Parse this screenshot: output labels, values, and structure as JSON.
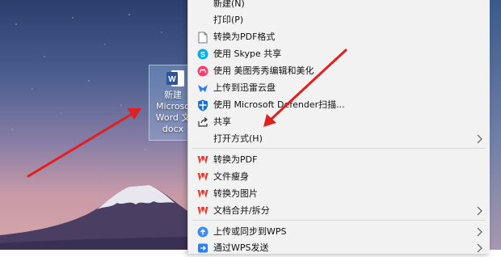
{
  "desktop": {
    "file": {
      "name_lines": [
        "新建",
        "Microso",
        "Word 文",
        "docx"
      ]
    }
  },
  "context_menu": {
    "items": [
      {
        "label": "新建(N)",
        "icon": "none"
      },
      {
        "label": "打印(P)",
        "icon": "none"
      },
      {
        "label": "转换为PDF格式",
        "icon": "document-icon"
      },
      {
        "label": "使用 Skype 共享",
        "icon": "skype-icon"
      },
      {
        "label": "使用 美图秀秀编辑和美化",
        "icon": "meitu-icon"
      },
      {
        "label": "上传到迅雷云盘",
        "icon": "xunlei-icon"
      },
      {
        "label": "使用 Microsoft Defender扫描...",
        "icon": "defender-shield-icon"
      },
      {
        "label": "共享",
        "icon": "share-icon"
      },
      {
        "label": "打开方式(H)",
        "icon": "none",
        "submenu": true
      },
      {
        "label": "转换为PDF",
        "icon": "wps-icon"
      },
      {
        "label": "文件瘦身",
        "icon": "wps-icon"
      },
      {
        "label": "转换为图片",
        "icon": "wps-icon"
      },
      {
        "label": "文档合并/拆分",
        "icon": "wps-icon",
        "submenu": true
      },
      {
        "label": "上传或同步到WPS",
        "icon": "wps-cloud-icon",
        "submenu": true
      },
      {
        "label": "通过WPS发送",
        "icon": "wps-send-icon",
        "submenu": true
      }
    ]
  },
  "colors": {
    "menu_bg": "#f2f2f2",
    "wps_red": "#e63c2e",
    "annotation_arrow": "#e02020",
    "word_blue": "#2b579a"
  }
}
